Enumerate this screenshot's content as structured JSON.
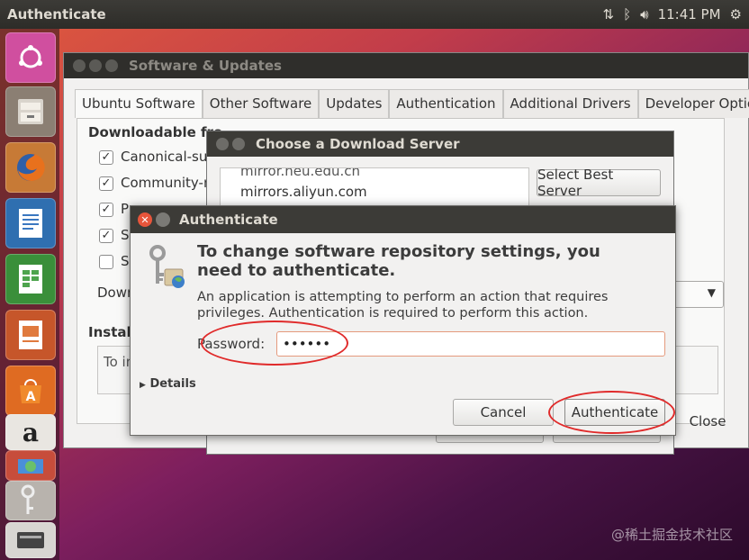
{
  "topbar": {
    "title": "Authenticate",
    "time": "11:41 PM",
    "icons": [
      "network-arrows-icon",
      "bluetooth-icon",
      "volume-icon",
      "settings-gear-icon"
    ]
  },
  "launcher": {
    "icons": [
      "ubuntu-dash-icon",
      "files-icon",
      "firefox-icon",
      "libreoffice-writer-icon",
      "libreoffice-calc-icon",
      "libreoffice-impress-icon",
      "software-center-icon",
      "amazon-icon",
      "software-updates-icon",
      "keys-icon",
      "drive-icon"
    ]
  },
  "software_window": {
    "title": "Software & Updates",
    "tabs": [
      "Ubuntu Software",
      "Other Software",
      "Updates",
      "Authentication",
      "Additional Drivers",
      "Developer Option"
    ],
    "section_download": "Downloadable fro",
    "checks": [
      "Canonical-sup",
      "Community-m",
      "Pr",
      "Sc",
      "Sc"
    ],
    "download_label": "Down",
    "install_label": "Install",
    "install_box": "To in",
    "close_label": "Close"
  },
  "server_dialog": {
    "title": "Choose a Download Server",
    "list": [
      "mirror.neu.edu.cn",
      "mirrors.aliyun.com"
    ],
    "select_best": "Select Best Server"
  },
  "auth": {
    "title": "Authenticate",
    "heading": "To change software repository settings, you need to authenticate.",
    "desc": "An application is attempting to perform an action that requires privileges. Authentication is required to perform this action.",
    "password_label": "Password:",
    "password_value": "••••••",
    "details": "Details",
    "cancel": "Cancel",
    "authenticate": "Authenticate"
  },
  "watermark": "@稀土掘金技术社区",
  "colors": {
    "annotation_red": "#e02a2a",
    "title_bar": "#3c3b37"
  }
}
